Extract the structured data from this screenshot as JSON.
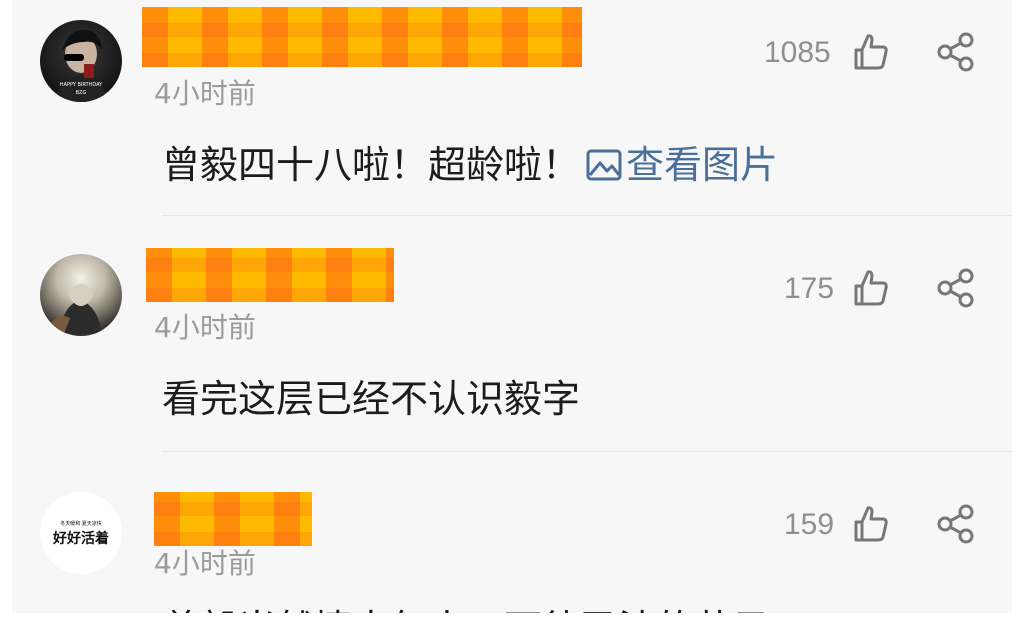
{
  "comments": [
    {
      "avatar_caption": "HAPPY BIRTHDAY",
      "avatar_caption_sub": "BZG",
      "time": "4小时前",
      "like_count": "1085",
      "text": "曾毅四十八啦！超龄啦！",
      "view_image_label": "查看图片"
    },
    {
      "time": "4小时前",
      "like_count": "175",
      "text": "看完这层已经不认识毅字"
    },
    {
      "avatar_small_text": "冬天暖和  夏天凉快",
      "avatar_text": "好好活着",
      "time": "4小时前",
      "like_count": "159",
      "text": "曾毅当然情中年人一可待已法的芳子"
    }
  ],
  "colors": {
    "background": "#f7f7f7",
    "text": "#1c1c1c",
    "meta": "#9b9b9b",
    "link": "#4a6f99",
    "name_mask": "#ffb000"
  },
  "icons": [
    "thumbs-up-icon",
    "share-icon",
    "image-icon"
  ]
}
